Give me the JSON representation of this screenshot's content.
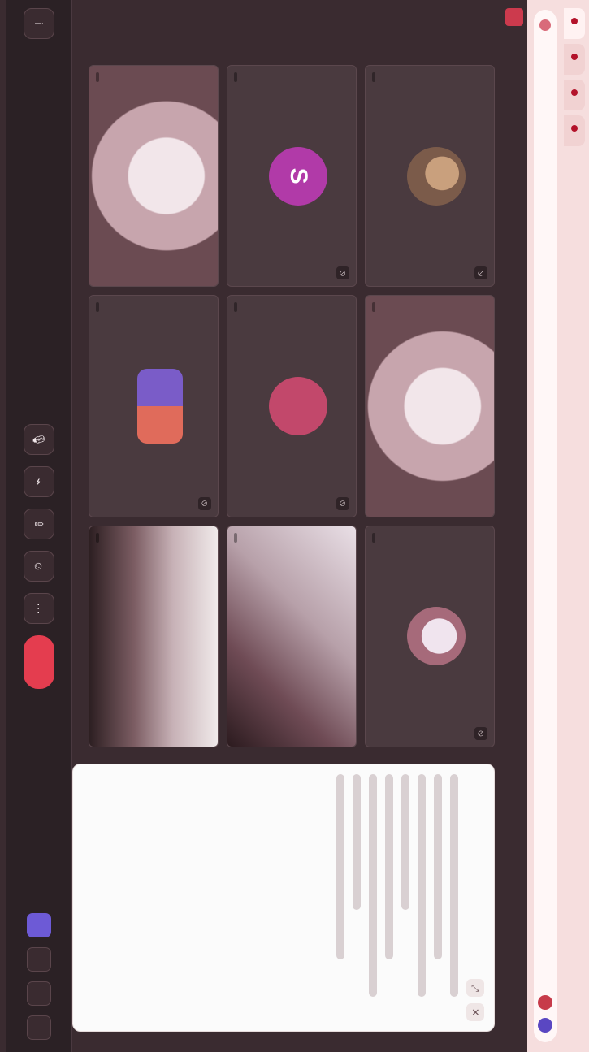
{
  "browser": {
    "tabs": [
      {
        "label": "",
        "active": true
      },
      {
        "label": "",
        "active": false
      },
      {
        "label": "",
        "active": false
      },
      {
        "label": "",
        "active": false
      }
    ],
    "address": ""
  },
  "meeting": {
    "title": "",
    "logo_text": "",
    "participants": [
      {
        "name": "",
        "type": "avatar",
        "avatar_style": "photo1",
        "initial": ""
      },
      {
        "name": "",
        "type": "avatar",
        "avatar_style": "face",
        "initial": ""
      },
      {
        "name": "",
        "type": "avatar",
        "avatar_style": "photo2",
        "initial": ""
      },
      {
        "name": "",
        "type": "avatar",
        "avatar_style": "magenta",
        "initial": "S"
      },
      {
        "name": "",
        "type": "avatar",
        "avatar_style": "pink",
        "initial": ""
      },
      {
        "name": "",
        "type": "video",
        "video_style": "room2"
      },
      {
        "name": "",
        "type": "video",
        "video_style": "face"
      },
      {
        "name": "",
        "type": "avatar",
        "avatar_style": "pair",
        "initial": ""
      },
      {
        "name": "",
        "type": "video",
        "video_style": "room3"
      }
    ]
  },
  "chat": {
    "title": "",
    "lines": [
      "long",
      "mid",
      "long",
      "short",
      "mid",
      "long",
      "short",
      "mid"
    ]
  },
  "toolbar": {
    "left_label": "",
    "center_buttons": [
      "mic",
      "camera",
      "share",
      "react",
      "more"
    ],
    "end_label": "",
    "right_buttons": [
      "chat",
      "participants",
      "apps",
      "settings"
    ]
  },
  "colors": {
    "end_call": "#e43d4f",
    "accent": "#6d5ad6"
  }
}
